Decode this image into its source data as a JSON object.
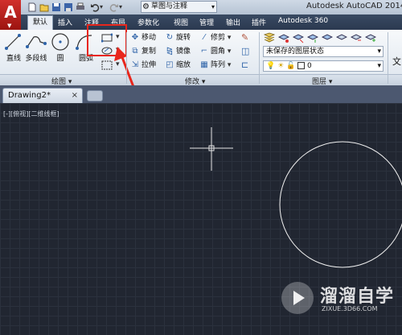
{
  "titlebar": {
    "app_title": "Autodesk AutoCAD 2014",
    "workspace": "草图与注释"
  },
  "ribbon_tabs": [
    {
      "label": "默认",
      "active": true
    },
    {
      "label": "插入"
    },
    {
      "label": "注释"
    },
    {
      "label": "布局"
    },
    {
      "label": "参数化"
    },
    {
      "label": "视图"
    },
    {
      "label": "管理"
    },
    {
      "label": "输出"
    },
    {
      "label": "插件"
    },
    {
      "label": "Autodesk 360"
    }
  ],
  "draw_panel": {
    "label": "绘图",
    "buttons": {
      "line": "直线",
      "polyline": "多段线",
      "circle": "圆",
      "arc": "圆弧"
    }
  },
  "modify_panel": {
    "label": "修改",
    "buttons": {
      "move": "移动",
      "rotate": "旋转",
      "trim": "修剪",
      "copy": "复制",
      "mirror": "镜像",
      "fillet": "圆角",
      "stretch": "拉伸",
      "scale": "缩放",
      "array": "阵列"
    }
  },
  "layers_panel": {
    "label": "图层",
    "layer_state": "未保存的图层状态",
    "current_layer": "0"
  },
  "annotation_partial": "文",
  "document": {
    "tab_label": "Drawing2*",
    "close_glyph": "×"
  },
  "viewport": {
    "label": "[-][俯视][二维线框]"
  },
  "watermark": {
    "title": "溜溜自学",
    "url": "ZIXUE.3D66.COM"
  },
  "colors": {
    "accent_red": "#e8261c",
    "canvas_bg": "#212631",
    "tab_bar": "#2b3950"
  }
}
